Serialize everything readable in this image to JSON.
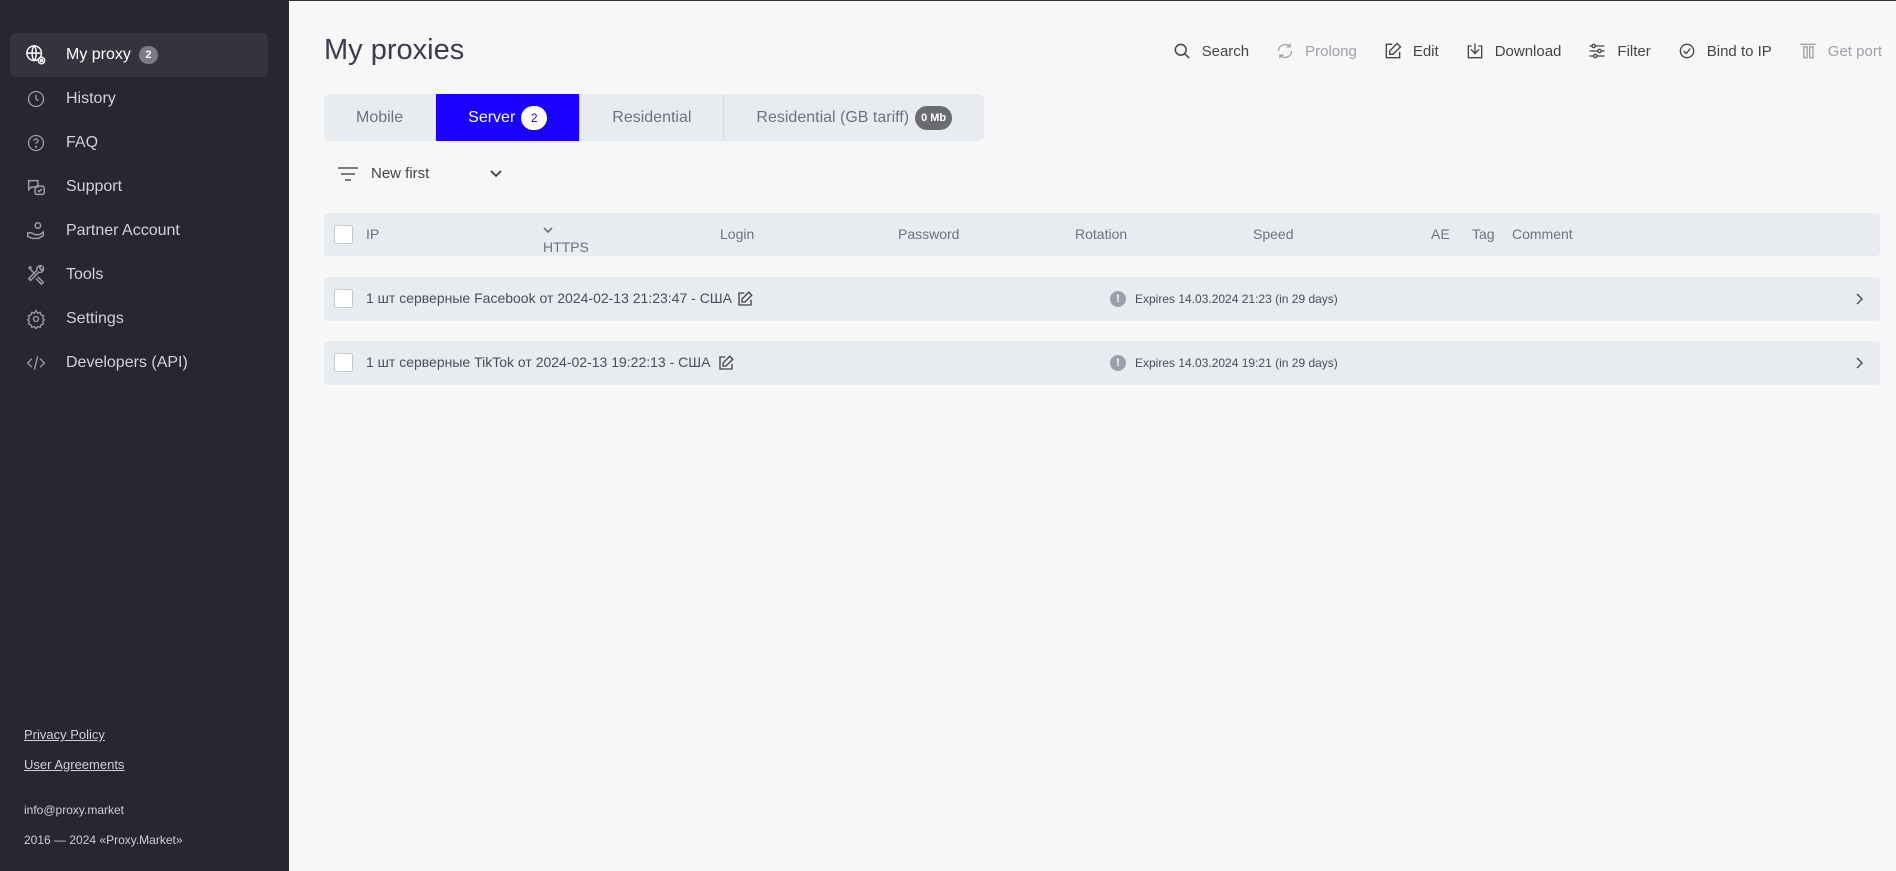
{
  "sidebar": {
    "items": [
      {
        "label": "My proxy",
        "badge": "2",
        "icon": "globe-gear-icon"
      },
      {
        "label": "History",
        "icon": "clock-icon"
      },
      {
        "label": "FAQ",
        "icon": "question-icon"
      },
      {
        "label": "Support",
        "icon": "chat-icon"
      },
      {
        "label": "Partner Account",
        "icon": "hand-coin-icon"
      },
      {
        "label": "Tools",
        "icon": "tools-icon"
      },
      {
        "label": "Settings",
        "icon": "gear-icon"
      },
      {
        "label": "Developers (API)",
        "icon": "code-icon"
      }
    ],
    "privacy": "Privacy Policy",
    "agreements": "User Agreements",
    "email": "info@proxy.market",
    "copyright": "2016 — 2024 «Proxy.Market»"
  },
  "main": {
    "title": "My proxies",
    "toolbar": {
      "search": "Search",
      "prolong": "Prolong",
      "edit": "Edit",
      "download": "Download",
      "filter": "Filter",
      "bind": "Bind to IP",
      "getport": "Get port"
    },
    "tabs": [
      {
        "label": "Mobile"
      },
      {
        "label": "Server",
        "badge": "2"
      },
      {
        "label": "Residential"
      },
      {
        "label": "Residential (GB tariff)",
        "badge": "0 Mb"
      }
    ],
    "sort": "New first",
    "columns": {
      "ip": "IP",
      "protocol": "HTTPS",
      "login": "Login",
      "password": "Password",
      "rotation": "Rotation",
      "speed": "Speed",
      "ae": "AE",
      "tag": "Tag",
      "comment": "Comment"
    },
    "rows": [
      {
        "name": "1 шт серверные Facebook от 2024-02-13 21:23:47 - США",
        "expires": "Expires 14.03.2024 21:23 (in 29 days)"
      },
      {
        "name": "1 шт серверные TikTok от 2024-02-13 19:22:13 - США",
        "expires": "Expires 14.03.2024 19:21 (in 29 days)"
      }
    ]
  },
  "colors": {
    "accent": "#1a00ff",
    "sidebar_bg": "#272631"
  }
}
